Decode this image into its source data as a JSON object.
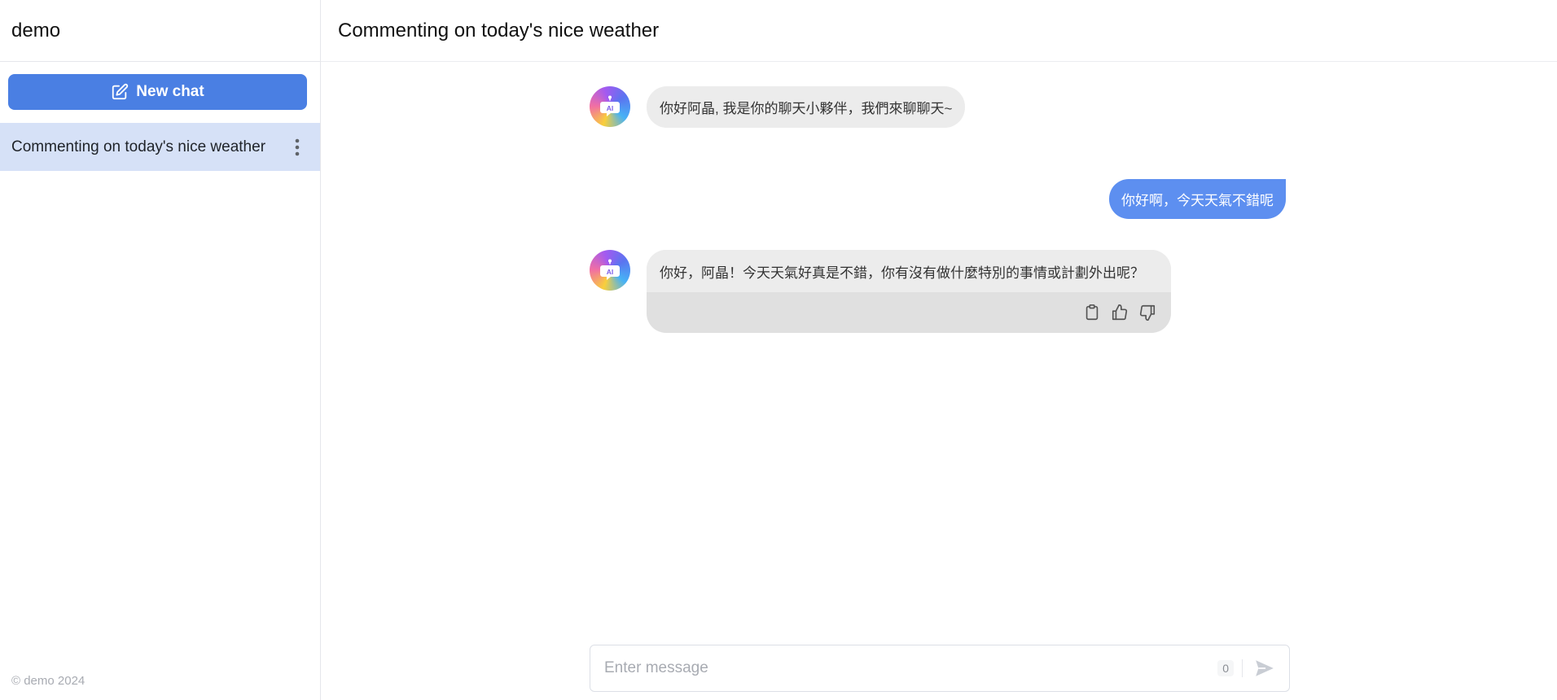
{
  "sidebar": {
    "app_name": "demo",
    "new_chat_label": "New chat",
    "history": [
      {
        "title": "Commenting on today's nice weather"
      }
    ],
    "footer": "© demo 2024"
  },
  "main": {
    "title": "Commenting on today's nice weather",
    "messages": [
      {
        "role": "assistant",
        "text": "你好阿晶, 我是你的聊天小夥伴，我們來聊聊天~"
      },
      {
        "role": "user",
        "text": "你好啊，今天天氣不錯呢"
      },
      {
        "role": "assistant",
        "text": "你好，阿晶！今天天氣好真是不錯，你有沒有做什麼特別的事情或計劃外出呢？"
      }
    ],
    "avatar_label": "AI"
  },
  "composer": {
    "placeholder": "Enter message",
    "char_count": "0"
  },
  "colors": {
    "accent": "#4a7fe3",
    "user_bubble": "#5d8ff0",
    "active_history": "#d6e1f7",
    "ai_bubble": "#ececec"
  },
  "icons": {
    "new_chat": "edit-icon",
    "history_more": "more-vertical-icon",
    "copy": "clipboard-icon",
    "like": "thumbs-up-icon",
    "dislike": "thumbs-down-icon",
    "send": "send-icon",
    "avatar": "ai-bot-icon"
  }
}
